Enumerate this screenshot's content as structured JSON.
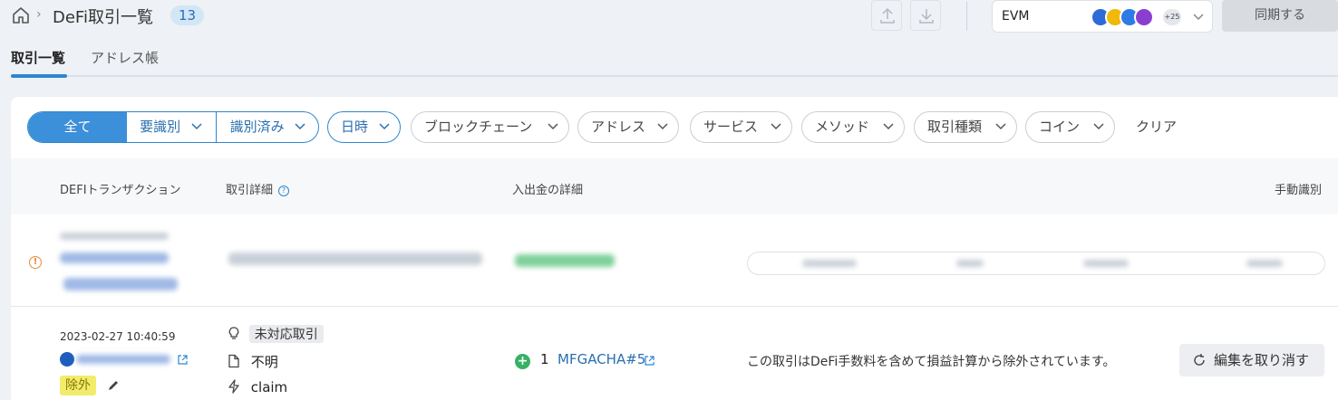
{
  "header": {
    "title": "DeFi取引一覧",
    "count": "13",
    "chain_select": {
      "label": "EVM",
      "extra_chains": "+25",
      "chain_icons": [
        "ethereum-icon",
        "bnb-icon",
        "chain-c-icon",
        "chain-op-icon"
      ]
    },
    "sync_label": "同期する"
  },
  "tabs": [
    {
      "label": "取引一覧",
      "active": true
    },
    {
      "label": "アドレス帳",
      "active": false
    }
  ],
  "filters": {
    "segments": [
      {
        "label": "全て",
        "active": true
      },
      {
        "label": "要識別",
        "active": false
      },
      {
        "label": "識別済み",
        "active": false
      }
    ],
    "chips": [
      {
        "label": "日時",
        "highlighted": true
      },
      {
        "label": "ブロックチェーン",
        "highlighted": false
      },
      {
        "label": "アドレス",
        "highlighted": false
      },
      {
        "label": "サービス",
        "highlighted": false
      },
      {
        "label": "メソッド",
        "highlighted": false
      },
      {
        "label": "取引種類",
        "highlighted": false
      },
      {
        "label": "コイン",
        "highlighted": false
      }
    ],
    "clear_label": "クリア"
  },
  "table": {
    "columns": [
      "DEFIトランザクション",
      "取引詳細",
      "入出金の詳細",
      "手動識別"
    ],
    "rows": [
      {
        "blurred": true,
        "status": "warning"
      },
      {
        "blurred": false,
        "datetime": "2023-02-27 10:40:59",
        "exclude_tag": "除外",
        "details": {
          "unsupported_tag": "未対応取引",
          "type": "不明",
          "method": "claim"
        },
        "transfer": {
          "amount": "1",
          "token": "MFGACHA#5"
        },
        "note": "この取引はDeFi手数料を含めて損益計算から除外されています。",
        "undo_label": "編集を取り消す"
      }
    ]
  },
  "colors": {
    "accent": "#2e86cf",
    "exclude_tag_bg": "#f2ec6c",
    "positive": "#36b265",
    "warning": "#e38b3a"
  }
}
